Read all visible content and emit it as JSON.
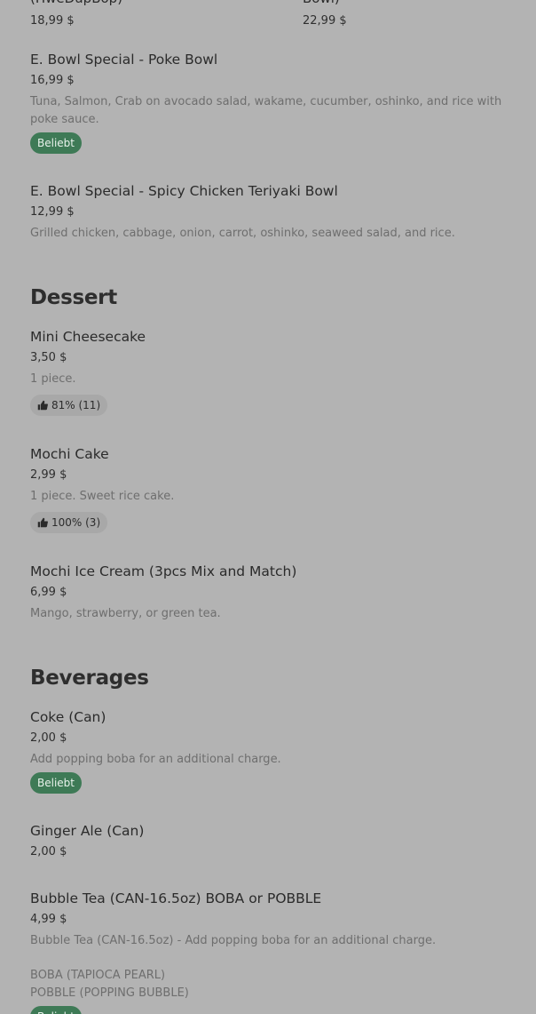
{
  "top_row": [
    {
      "name": "(HweDupBop)",
      "price": "18,99 $"
    },
    {
      "name": "Bowl)",
      "price": "22,99 $"
    }
  ],
  "items_main": [
    {
      "name": "E. Bowl Special - Poke Bowl",
      "price": "16,99 $",
      "description": "Tuna, Salmon, Crab on avocado salad, wakame, cucumber, oshinko, and rice with poke sauce.",
      "badge": "Beliebt"
    },
    {
      "name": "E. Bowl Special - Spicy Chicken Teriyaki Bowl",
      "price": "12,99 $",
      "description": "Grilled chicken, cabbage, onion, carrot, oshinko, seaweed salad, and rice."
    }
  ],
  "dessert": {
    "title": "Dessert",
    "items": [
      {
        "name": "Mini Cheesecake",
        "price": "3,50 $",
        "description": "1 piece.",
        "rating": "81% (11)"
      },
      {
        "name": "Mochi Cake",
        "price": "2,99 $",
        "description": "1 piece. Sweet rice cake.",
        "rating": "100% (3)"
      },
      {
        "name": "Mochi Ice Cream (3pcs Mix and Match)",
        "price": "6,99 $",
        "description": "Mango, strawberry, or green tea."
      }
    ]
  },
  "beverages": {
    "title": "Beverages",
    "items": [
      {
        "name": "Coke (Can)",
        "price": "2,00 $",
        "description": "Add popping boba for an additional charge.",
        "badge": "Beliebt"
      },
      {
        "name": "Ginger Ale (Can)",
        "price": "2,00 $"
      },
      {
        "name": "Bubble Tea (CAN-16.5oz) BOBA or POBBLE",
        "price": "4,99 $",
        "description": "Bubble Tea (CAN-16.5oz) - Add popping boba for an additional charge.",
        "description_line2": "BOBA (TAPIOCA PEARL)",
        "description_line3": "POBBLE (POPPING BUBBLE)",
        "badge": "Beliebt"
      }
    ]
  },
  "icons": {
    "rating": "thumbs-up-icon"
  },
  "colors": {
    "badge_bg": "#3e7a56",
    "background": "#b3b3b3"
  }
}
